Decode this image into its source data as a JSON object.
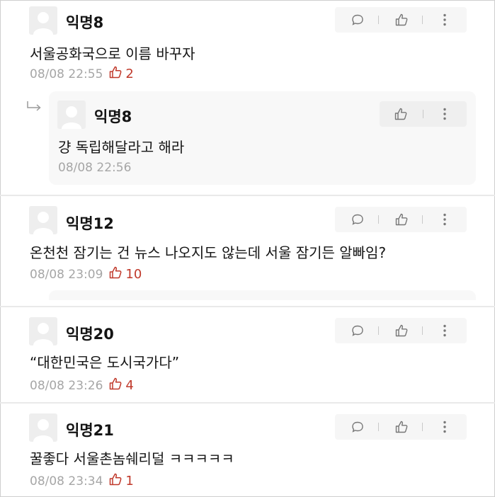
{
  "comments": [
    {
      "author": "익명8",
      "text": "서울공화국으로 이름 바꾸자",
      "time": "08/08 22:55",
      "votes": "2",
      "reply": {
        "author": "익명8",
        "text": "걍 독립해달라고 해라",
        "time": "08/08 22:56"
      }
    },
    {
      "author": "익명12",
      "text": "온천천 잠기는 건 뉴스 나오지도 않는데 서울 잠기든 알빠임?",
      "time": "08/08 23:09",
      "votes": "10"
    },
    {
      "author": "익명20",
      "text": "“대한민국은 도시국가다”",
      "time": "08/08 23:26",
      "votes": "4"
    },
    {
      "author": "익명21",
      "text": "꿀좋다 서울촌놈쉐리덜 ㅋㅋㅋㅋㅋ",
      "time": "08/08 23:34",
      "votes": "1"
    }
  ],
  "colors": {
    "vote": "#c0392b",
    "meta": "#a6a6a6",
    "action_bg": "#f6f6f6",
    "reply_bg": "#f8f8f8"
  },
  "icons": {
    "avatar": "anonymous-avatar-icon",
    "reply": "speech-bubble-icon",
    "vote": "thumbs-up-icon",
    "more": "more-vertical-icon",
    "reply_indicator": "reply-arrow-icon"
  }
}
